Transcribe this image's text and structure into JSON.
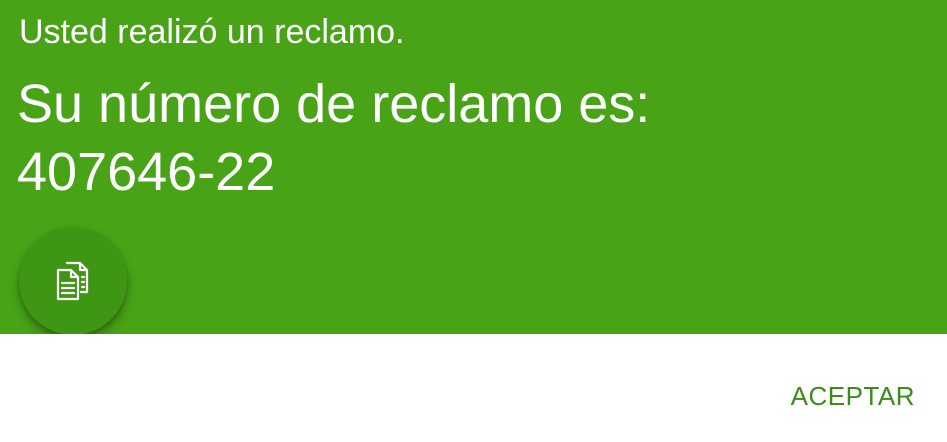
{
  "dialog": {
    "subtitle": "Usted realizó un reclamo.",
    "headline_line1": "Su número de reclamo es:",
    "claim_number": "407646-22",
    "copy_icon": "copy-documents-icon",
    "accept_label": "ACEPTAR"
  },
  "colors": {
    "header_bg": "#48a317",
    "fab_bg": "#3e9614",
    "accent_text": "#3d8b1a",
    "text_on_header": "#ffffff"
  }
}
